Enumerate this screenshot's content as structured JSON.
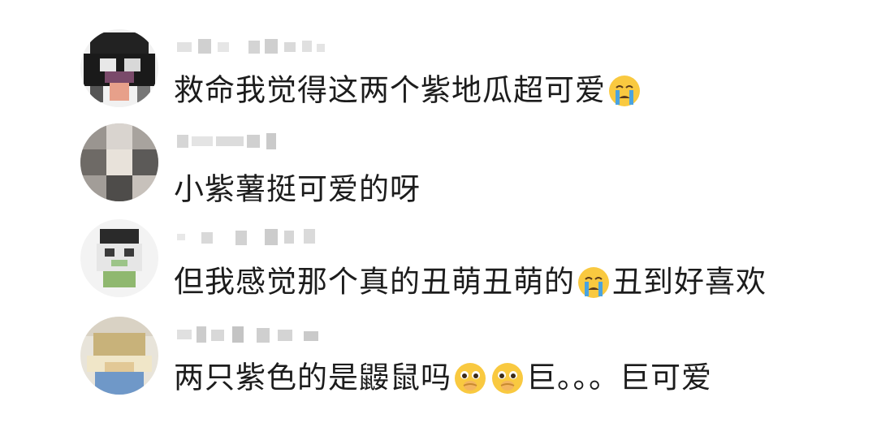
{
  "comments": [
    {
      "username": "",
      "text_parts": [
        "救命我觉得这两个紫地瓜超可爱"
      ],
      "emojis": [
        "crying-emoji"
      ]
    },
    {
      "username": "",
      "text_parts": [
        "小紫薯挺可爱的呀"
      ],
      "emojis": []
    },
    {
      "username": "",
      "text_parts": [
        "但我感觉那个真的丑萌丑萌的",
        "丑到好喜欢"
      ],
      "emojis": [
        "crying-emoji"
      ]
    },
    {
      "username": "",
      "text_parts": [
        "两只紫色的是鼹鼠吗",
        "巨。。。巨可爱"
      ],
      "emojis": [
        "pleading-emoji",
        "pleading-emoji"
      ]
    }
  ],
  "colors": {
    "text": "#1c1c1c",
    "emoji_face": "#f9c940",
    "emoji_tears": "#4aa3e0",
    "pixelated_gray": "#d9d9d9"
  }
}
